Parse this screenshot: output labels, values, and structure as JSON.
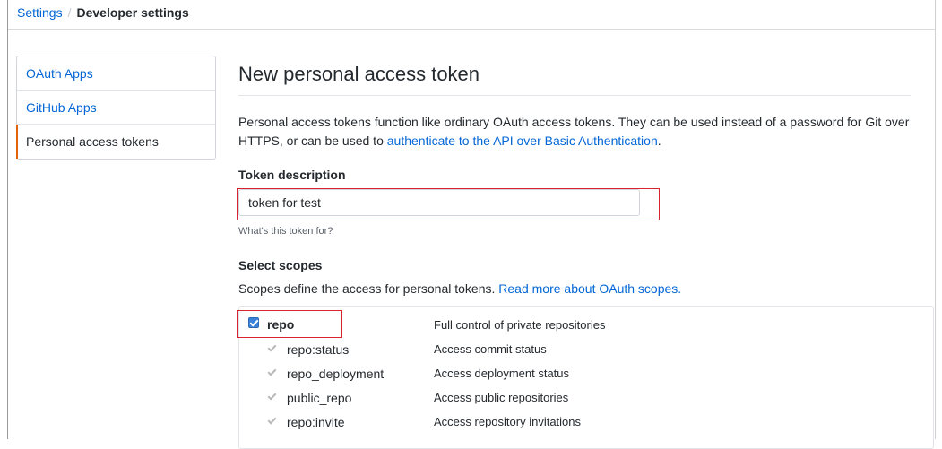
{
  "breadcrumb": {
    "parent": "Settings",
    "separator": "/",
    "current": "Developer settings"
  },
  "sidebar": {
    "items": [
      {
        "label": "OAuth Apps"
      },
      {
        "label": "GitHub Apps"
      },
      {
        "label": "Personal access tokens"
      }
    ]
  },
  "page": {
    "title": "New personal access token",
    "intro_text": "Personal access tokens function like ordinary OAuth access tokens. They can be used instead of a password for Git over HTTPS, or can be used to ",
    "intro_link": "authenticate to the API over Basic Authentication",
    "intro_end": "."
  },
  "token": {
    "label": "Token description",
    "value": "token for test",
    "hint": "What's this token for?"
  },
  "scopes": {
    "label": "Select scopes",
    "desc_text": "Scopes define the access for personal tokens. ",
    "desc_link": "Read more about OAuth scopes.",
    "items": [
      {
        "name": "repo",
        "desc": "Full control of private repositories"
      },
      {
        "name": "repo:status",
        "desc": "Access commit status"
      },
      {
        "name": "repo_deployment",
        "desc": "Access deployment status"
      },
      {
        "name": "public_repo",
        "desc": "Access public repositories"
      },
      {
        "name": "repo:invite",
        "desc": "Access repository invitations"
      }
    ]
  },
  "colors": {
    "link": "#0366d6",
    "highlight": "#d9232e",
    "active_indicator": "#e36209",
    "checkbox": "#3a82d8"
  }
}
